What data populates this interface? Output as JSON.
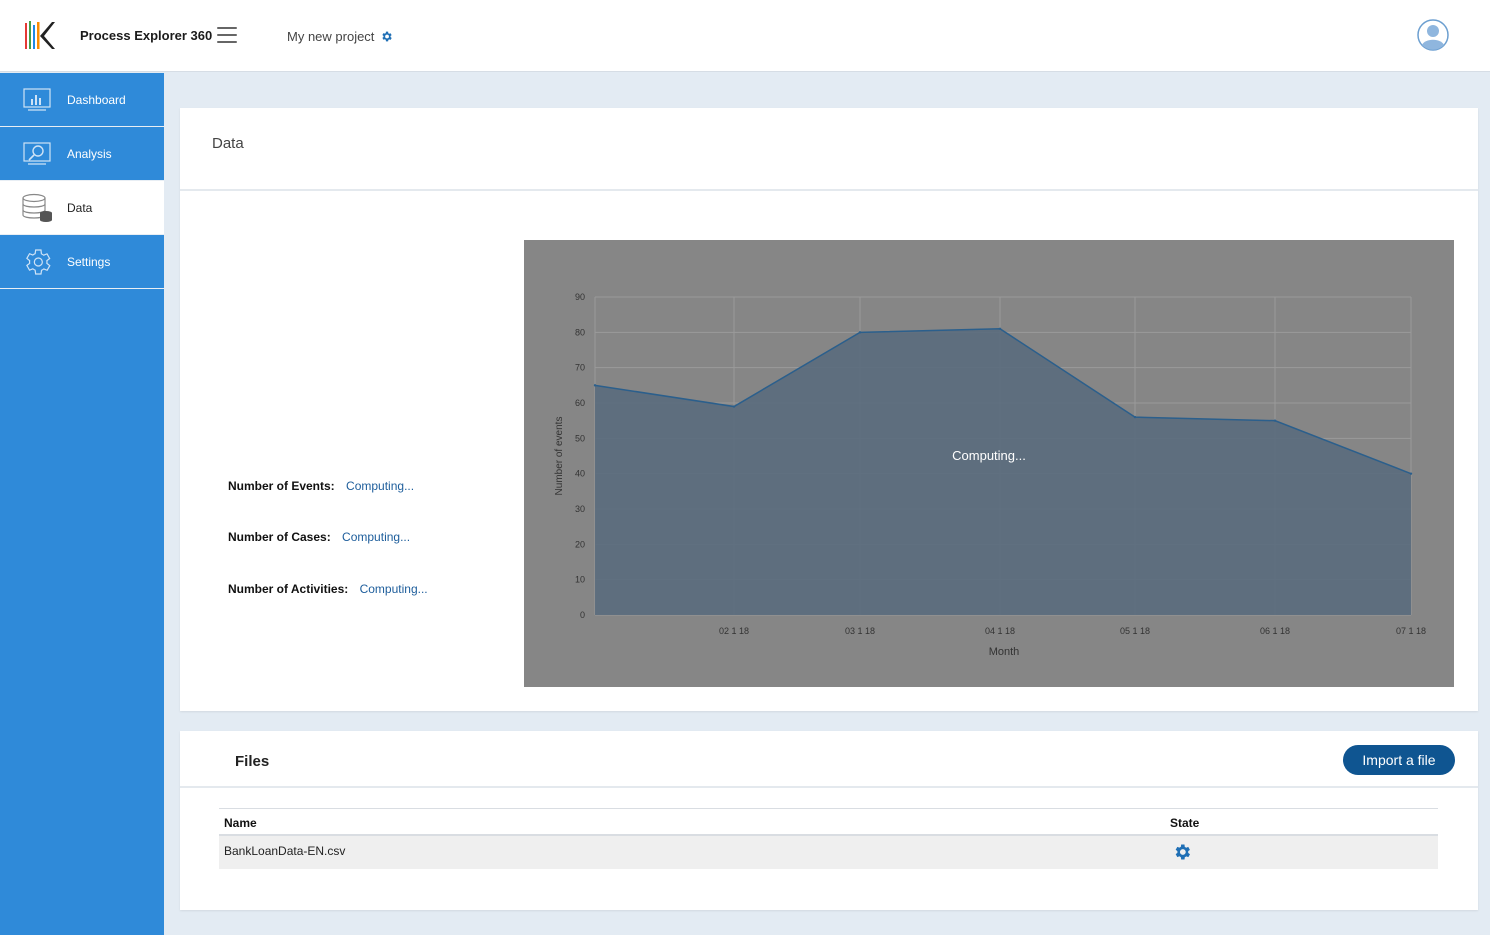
{
  "header": {
    "app_title": "Process Explorer 360",
    "project_name": "My new project",
    "logo_colors": [
      "#e53935",
      "#43a047",
      "#1e88e5",
      "#fb8c00",
      "#222222"
    ]
  },
  "sidebar": {
    "items": [
      {
        "label": "Dashboard",
        "icon": "dashboard-chart-icon",
        "active": false
      },
      {
        "label": "Analysis",
        "icon": "analysis-magnifier-icon",
        "active": false
      },
      {
        "label": "Data",
        "icon": "database-stack-icon",
        "active": true
      },
      {
        "label": "Settings",
        "icon": "gear-icon",
        "active": false
      }
    ]
  },
  "data_card": {
    "title": "Data",
    "stats": [
      {
        "label": "Number of Events:",
        "value": "Computing..."
      },
      {
        "label": "Number of Cases:",
        "value": "Computing..."
      },
      {
        "label": "Number of Activities:",
        "value": "Computing..."
      }
    ],
    "overlay_text": "Computing..."
  },
  "chart_data": {
    "type": "area",
    "xlabel": "Month",
    "ylabel": "Number of events",
    "x_tick_labels": [
      "02 1 18",
      "03 1 18",
      "04 1 18",
      "05 1 18",
      "06 1 18",
      "07 1 18"
    ],
    "points": [
      {
        "x": "01 1 18",
        "y": 65
      },
      {
        "x": "02 1 18",
        "y": 59
      },
      {
        "x": "03 1 18",
        "y": 80
      },
      {
        "x": "04 1 18",
        "y": 81
      },
      {
        "x": "05 1 18",
        "y": 56
      },
      {
        "x": "06 1 18",
        "y": 55
      },
      {
        "x": "07 1 18",
        "y": 40
      }
    ],
    "ylim": [
      0,
      90
    ],
    "yticks": [
      0,
      10,
      20,
      30,
      40,
      50,
      60,
      70,
      80,
      90
    ],
    "grid": true,
    "colors": {
      "fill": "#5a6c7d",
      "line": "#2b5f8c",
      "overlay": "#868686"
    }
  },
  "files_card": {
    "title": "Files",
    "import_button": "Import a file",
    "columns": [
      "Name",
      "State"
    ],
    "rows": [
      {
        "name": "BankLoanData-EN.csv",
        "state_icon": "gear-icon"
      }
    ]
  },
  "colors": {
    "sidebar": "#2f8ad9",
    "accent": "#0f5591",
    "link": "#1d5d9b"
  }
}
